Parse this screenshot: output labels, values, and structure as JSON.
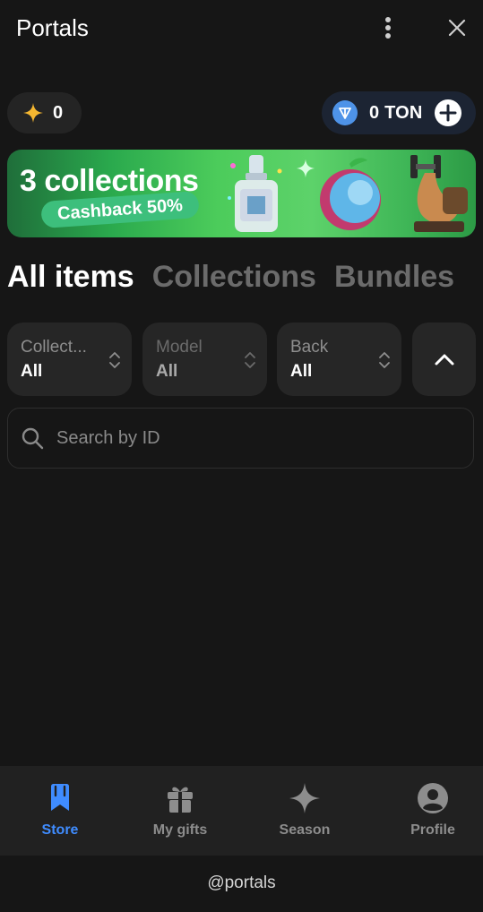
{
  "header": {
    "title": "Portals"
  },
  "balances": {
    "stars": "0",
    "ton": "0 TON"
  },
  "banner": {
    "headline": "3 collections",
    "badge": "Cashback 50%"
  },
  "tabs": [
    {
      "label": "All items",
      "active": true
    },
    {
      "label": "Collections",
      "active": false
    },
    {
      "label": "Bundles",
      "active": false
    }
  ],
  "filters": [
    {
      "label": "Collect...",
      "value": "All",
      "enabled": true
    },
    {
      "label": "Model",
      "value": "All",
      "enabled": false
    },
    {
      "label": "Back",
      "value": "All",
      "enabled": true
    }
  ],
  "search": {
    "placeholder": "Search by ID"
  },
  "nav": [
    {
      "label": "Store",
      "icon": "store-icon",
      "active": true
    },
    {
      "label": "My gifts",
      "icon": "gift-icon",
      "active": false
    },
    {
      "label": "Season",
      "icon": "sparkle-icon",
      "active": false
    },
    {
      "label": "Profile",
      "icon": "profile-icon",
      "active": false
    }
  ],
  "footer": {
    "handle": "@portals"
  },
  "colors": {
    "accent": "#3f8cff",
    "background": "#161616",
    "card": "#262626",
    "banner": "#4ccc5b",
    "star": "#f5b731",
    "ton": "#4e93e8"
  }
}
